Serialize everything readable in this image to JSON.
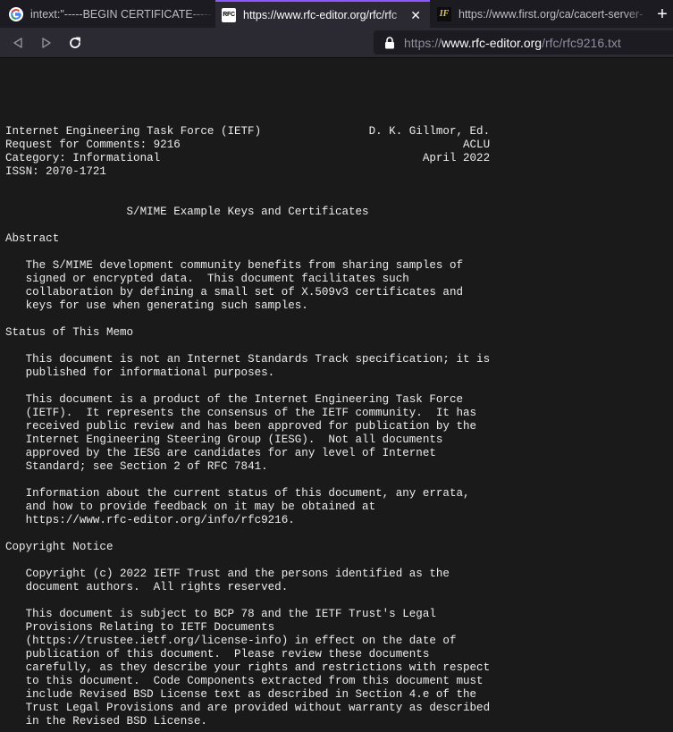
{
  "browser": {
    "tabs": [
      {
        "title": "intext:\"-----BEGIN CERTIFICATE-----\" e",
        "favicon": "google-icon",
        "active": false
      },
      {
        "title": "https://www.rfc-editor.org/rfc/rfc",
        "favicon": "rfc-icon",
        "favicon_text": "RFC",
        "active": true,
        "close": "✕"
      },
      {
        "title": "https://www.first.org/ca/cacert-server-",
        "favicon": "first-icon",
        "favicon_text": "IF",
        "active": false
      }
    ],
    "new_tab": "+",
    "url": {
      "scheme": "https://",
      "host": "www.rfc-editor.org",
      "path": "/rfc/rfc9216.txt"
    }
  },
  "document": {
    "header": [
      "Internet Engineering Task Force (IETF)                D. K. Gillmor, Ed.",
      "Request for Comments: 9216                                          ACLU",
      "Category: Informational                                       April 2022",
      "ISSN: 2070-1721"
    ],
    "title": "S/MIME Example Keys and Certificates",
    "abstract_heading": "Abstract",
    "abstract": [
      "The S/MIME development community benefits from sharing samples of",
      "signed or encrypted data.  This document facilitates such",
      "collaboration by defining a small set of X.509v3 certificates and",
      "keys for use when generating such samples."
    ],
    "status_heading": "Status of This Memo",
    "status_p1": [
      "This document is not an Internet Standards Track specification; it is",
      "published for informational purposes."
    ],
    "status_p2": [
      "This document is a product of the Internet Engineering Task Force",
      "(IETF).  It represents the consensus of the IETF community.  It has",
      "received public review and has been approved for publication by the",
      "Internet Engineering Steering Group (IESG).  Not all documents",
      "approved by the IESG are candidates for any level of Internet",
      "Standard; see Section 2 of RFC 7841."
    ],
    "status_p3": [
      "Information about the current status of this document, any errata,",
      "and how to provide feedback on it may be obtained at",
      "https://www.rfc-editor.org/info/rfc9216."
    ],
    "copyright_heading": "Copyright Notice",
    "copyright_p1": [
      "Copyright (c) 2022 IETF Trust and the persons identified as the",
      "document authors.  All rights reserved."
    ],
    "copyright_p2": [
      "This document is subject to BCP 78 and the IETF Trust's Legal",
      "Provisions Relating to IETF Documents",
      "(https://trustee.ietf.org/license-info) in effect on the date of",
      "publication of this document.  Please review these documents",
      "carefully, as they describe your rights and restrictions with respect",
      "to this document.  Code Components extracted from this document must",
      "include Revised BSD License text as described in Section 4.e of the",
      "Trust Legal Provisions and are provided without warranty as described",
      "in the Revised BSD License."
    ]
  }
}
